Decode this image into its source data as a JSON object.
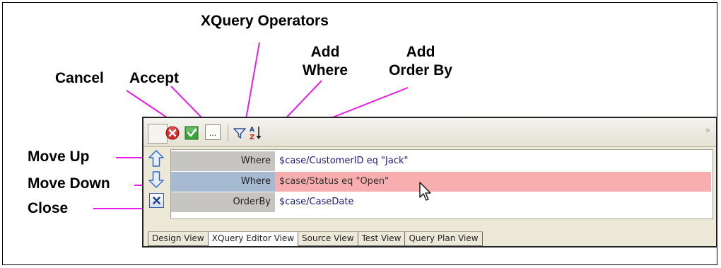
{
  "callouts": {
    "xquery_operators": "XQuery Operators",
    "add_where_1": "Add",
    "add_where_2": "Where",
    "add_order_1": "Add",
    "add_order_2": "Order By",
    "cancel": "Cancel",
    "accept": "Accept",
    "move_up": "Move Up",
    "move_down": "Move Down",
    "close": "Close"
  },
  "toolbar": {
    "ops_label": "...",
    "overflow_label": "»",
    "icons": [
      "cancel-icon",
      "accept-icon",
      "xquery-operators-icon",
      "filter-funnel-icon",
      "sort-az-icon"
    ]
  },
  "sidebar": {
    "icons": [
      "arrow-up-icon",
      "arrow-down-icon",
      "close-x-icon"
    ]
  },
  "grid": {
    "rows": [
      {
        "kind": "Where",
        "expression": "$case/CustomerID eq \"Jack\"",
        "selected": false
      },
      {
        "kind": "Where",
        "expression": "$case/Status eq \"Open\"",
        "selected": true
      },
      {
        "kind": "OrderBy",
        "expression": "$case/CaseDate",
        "selected": false
      }
    ]
  },
  "tabs": [
    {
      "label": "Design View",
      "active": false
    },
    {
      "label": "XQuery Editor View",
      "active": true
    },
    {
      "label": "Source View",
      "active": false
    },
    {
      "label": "Test View",
      "active": false
    },
    {
      "label": "Query Plan View",
      "active": false
    }
  ],
  "colors": {
    "callout_line": "#e81ee8",
    "selected_kind_bg": "#a6bad2",
    "selected_expr_bg": "#f8aeae"
  }
}
